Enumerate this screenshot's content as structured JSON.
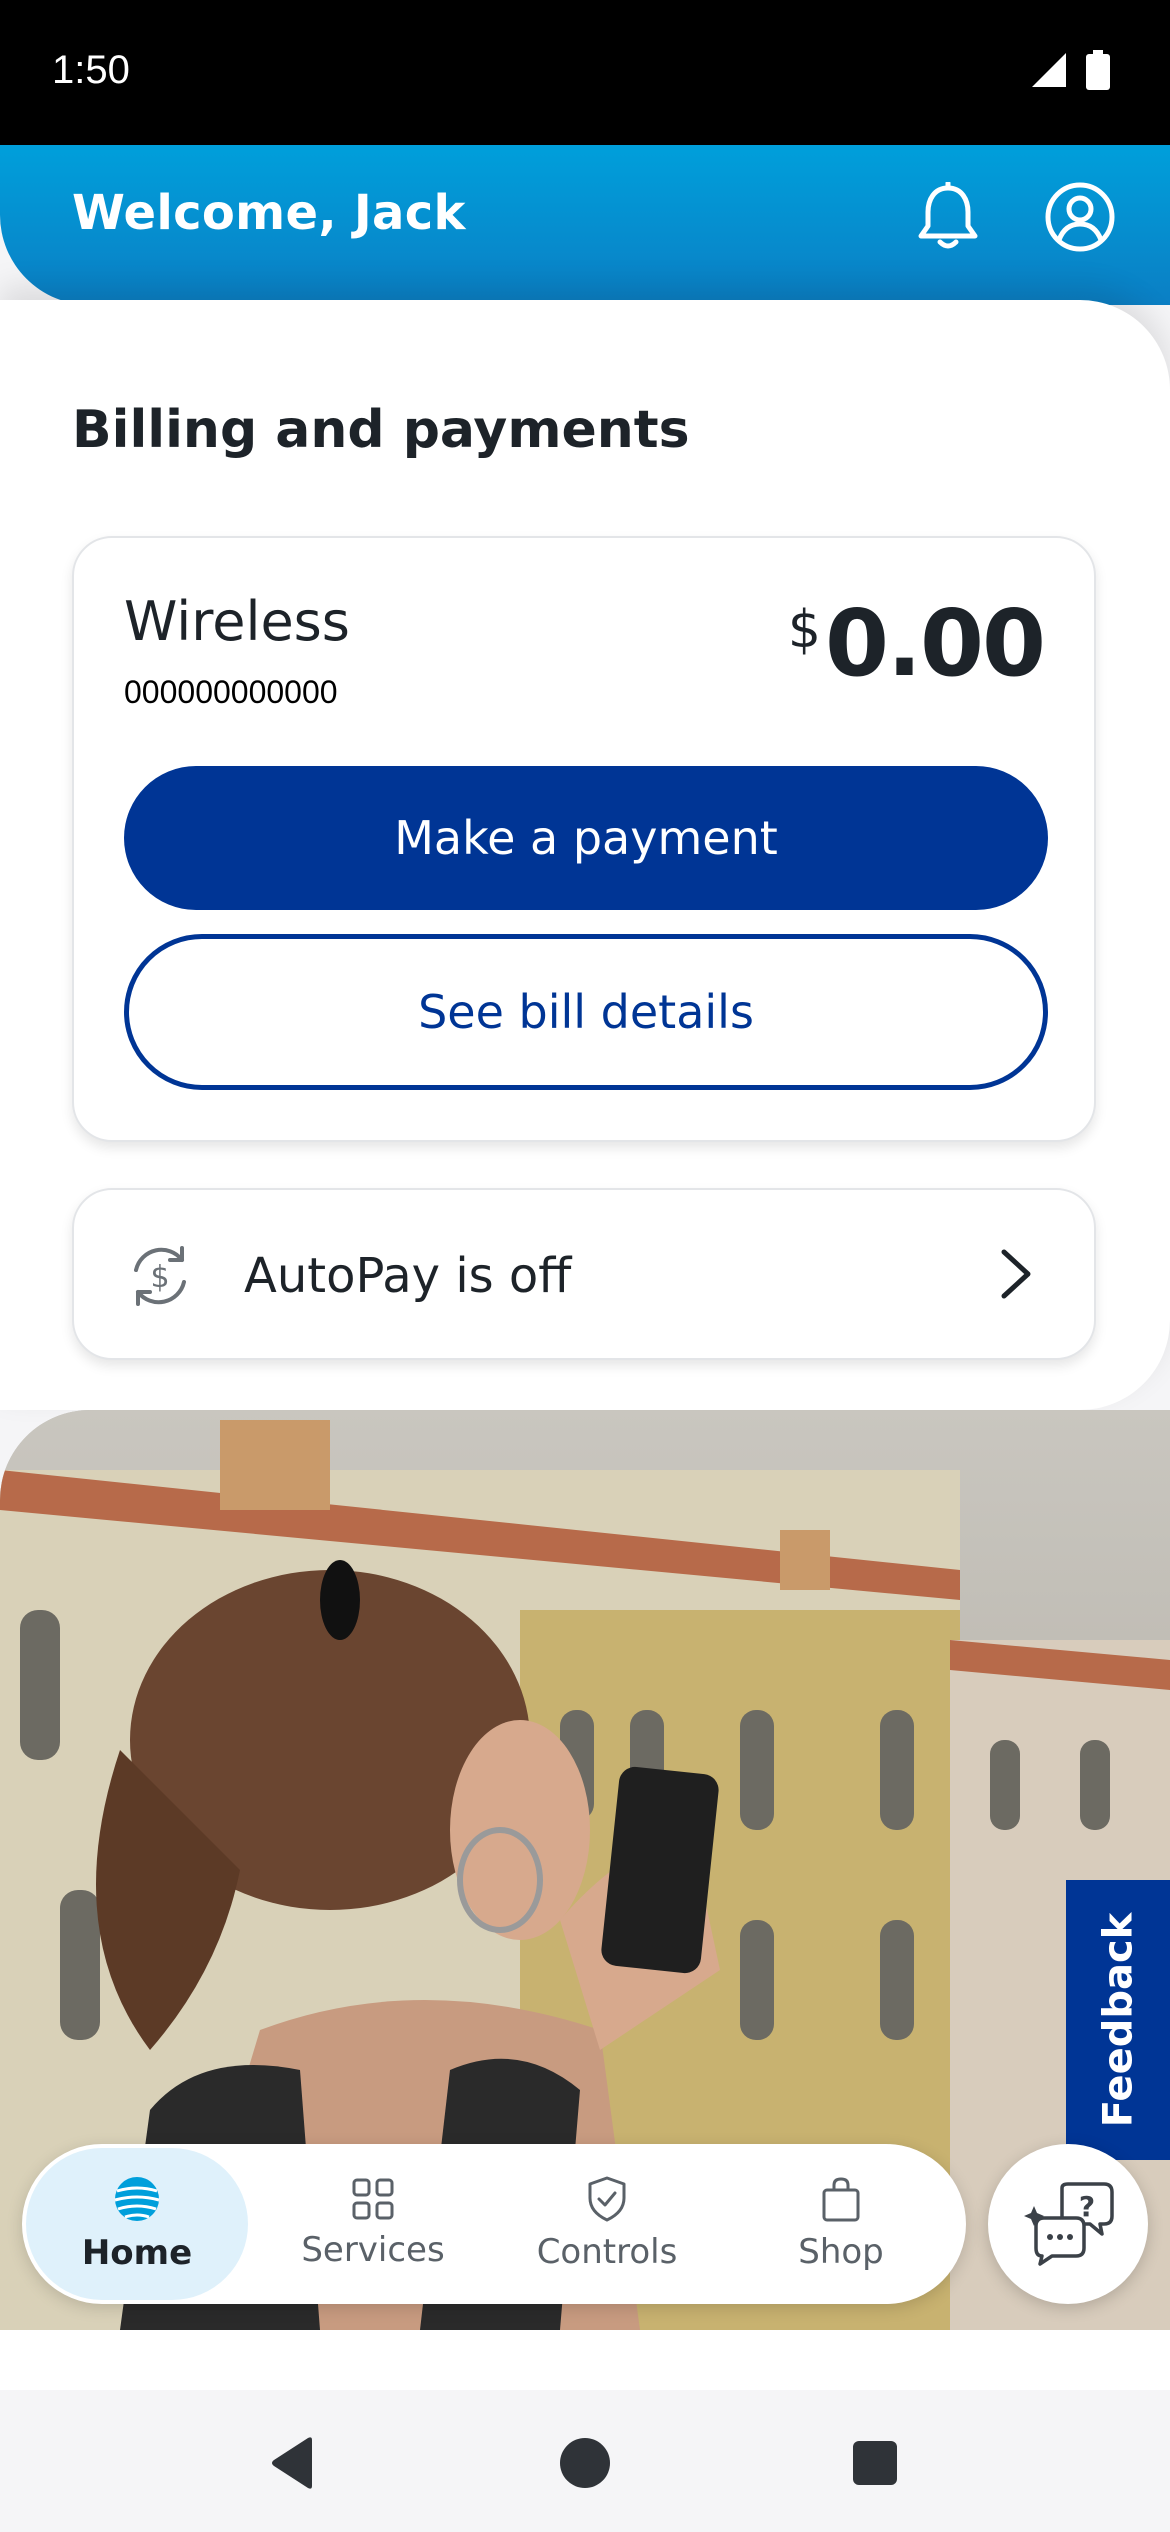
{
  "status_bar": {
    "time": "1:50",
    "icons": [
      "signal-icon",
      "battery-icon"
    ]
  },
  "header": {
    "welcome": "Welcome, Jack",
    "icons": [
      "bell-icon",
      "profile-icon"
    ]
  },
  "billing": {
    "title": "Billing and payments",
    "account_name": "Wireless",
    "account_number": "000000000000",
    "currency_symbol": "$",
    "amount": "0.00",
    "make_payment_label": "Make a payment",
    "bill_details_label": "See bill details"
  },
  "autopay": {
    "label": "AutoPay is off",
    "icon": "autopay-icon"
  },
  "feedback": {
    "label": "Feedback"
  },
  "bottom_nav": {
    "items": [
      {
        "label": "Home",
        "icon": "att-globe-icon",
        "active": true
      },
      {
        "label": "Services",
        "icon": "grid-icon",
        "active": false
      },
      {
        "label": "Controls",
        "icon": "shield-check-icon",
        "active": false
      },
      {
        "label": "Shop",
        "icon": "shopping-bag-icon",
        "active": false
      }
    ]
  },
  "chat": {
    "icon": "chat-assistant-icon"
  },
  "system_nav": {
    "icons": [
      "back-icon",
      "home-icon",
      "recents-icon"
    ]
  },
  "colors": {
    "brand_blue": "#003595",
    "header_blue": "#009fdb",
    "active_tab_bg": "#dff1fb"
  }
}
